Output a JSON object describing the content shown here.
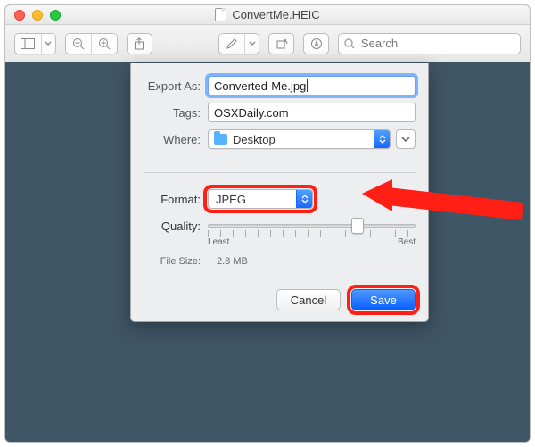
{
  "window": {
    "title": "ConvertMe.HEIC"
  },
  "toolbar": {
    "search_placeholder": "Search"
  },
  "sheet": {
    "labels": {
      "export_as": "Export As:",
      "tags": "Tags:",
      "where": "Where:",
      "format": "Format:",
      "quality": "Quality:",
      "least": "Least",
      "best": "Best",
      "file_size": "File Size:"
    },
    "export_as_value": "Converted-Me.jpg",
    "tags_value": "OSXDaily.com",
    "where_value": "Desktop",
    "format_value": "JPEG",
    "file_size_value": "2.8 MB",
    "buttons": {
      "cancel": "Cancel",
      "save": "Save"
    },
    "slider_pct": 72
  },
  "annotation": {
    "highlight_color": "#ff1f15"
  }
}
